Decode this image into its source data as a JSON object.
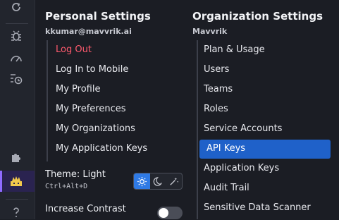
{
  "personal": {
    "title": "Personal Settings",
    "email": "kkumar@mavvrik.ai",
    "items": [
      {
        "label": "Log Out"
      },
      {
        "label": "Log In to Mobile"
      },
      {
        "label": "My Profile"
      },
      {
        "label": "My Preferences"
      },
      {
        "label": "My Organizations"
      },
      {
        "label": "My Application Keys"
      }
    ]
  },
  "organization": {
    "title": "Organization Settings",
    "name": "Mavvrik",
    "items": [
      {
        "label": "Plan & Usage"
      },
      {
        "label": "Users"
      },
      {
        "label": "Teams"
      },
      {
        "label": "Roles"
      },
      {
        "label": "Service Accounts"
      },
      {
        "label": "API Keys"
      },
      {
        "label": "Application Keys"
      },
      {
        "label": "Audit Trail"
      },
      {
        "label": "Sensitive Data Scanner"
      }
    ],
    "active_item": "API Keys"
  },
  "theme": {
    "label": "Theme: Light",
    "shortcut": "Ctrl+Alt+D",
    "options": [
      "light-icon",
      "moon-icon",
      "auto-wand-icon"
    ],
    "selected": "light"
  },
  "contrast": {
    "label": "Increase Contrast",
    "enabled": false
  },
  "colors": {
    "active": "#1f61c9",
    "logout": "#ff5a6e",
    "accent": "#8f6bff"
  }
}
